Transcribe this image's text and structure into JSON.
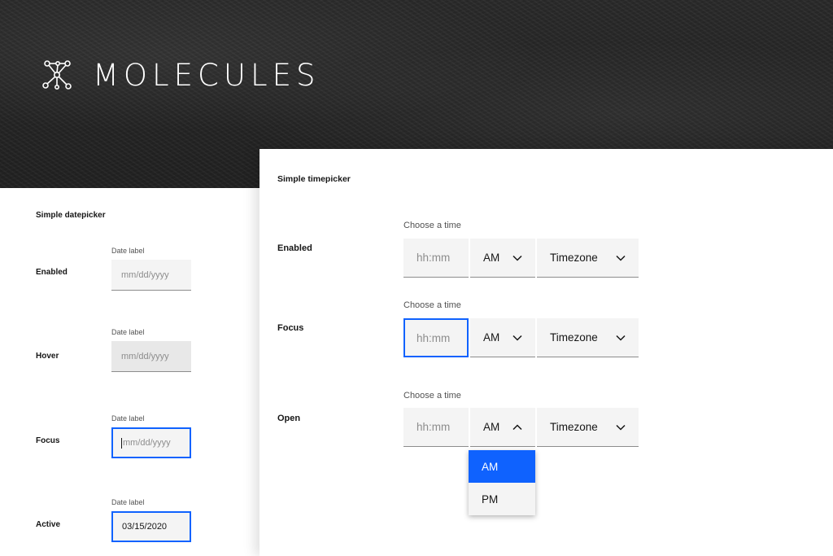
{
  "header": {
    "title": "MOLECULES",
    "logo_icon": "molecule-icon"
  },
  "datepicker": {
    "heading": "Simple datepicker",
    "rows": [
      {
        "state": "Enabled",
        "label": "Date label",
        "placeholder": "mm/dd/yyyy",
        "value": ""
      },
      {
        "state": "Hover",
        "label": "Date label",
        "placeholder": "mm/dd/yyyy",
        "value": ""
      },
      {
        "state": "Focus",
        "label": "Date label",
        "placeholder": "mm/dd/yyyy",
        "value": ""
      },
      {
        "state": "Active",
        "label": "Date label",
        "placeholder": "",
        "value": "03/15/2020"
      }
    ]
  },
  "timepicker": {
    "heading": "Simple timepicker",
    "rows": [
      {
        "state": "Enabled",
        "label": "Choose a time",
        "time_placeholder": "hh:mm",
        "period": "AM",
        "timezone": "Timezone"
      },
      {
        "state": "Focus",
        "label": "Choose a time",
        "time_placeholder": "hh:mm",
        "period": "AM",
        "timezone": "Timezone"
      },
      {
        "state": "Open",
        "label": "Choose a time",
        "time_placeholder": "hh:mm",
        "period": "AM",
        "timezone": "Timezone"
      }
    ],
    "period_options": [
      "AM",
      "PM"
    ],
    "selected_option": "AM"
  },
  "colors": {
    "accent": "#0f62fe",
    "field_bg": "#f4f4f4",
    "hover_bg": "#e8e8e8",
    "header_bg": "#262626"
  }
}
